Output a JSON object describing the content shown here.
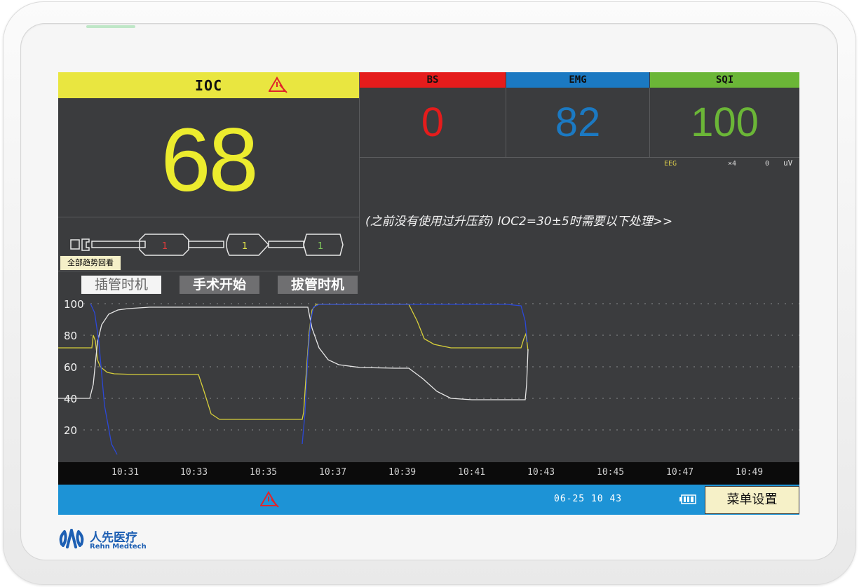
{
  "ioc": {
    "title": "IOC",
    "value": "68",
    "header_color": "#e9e640",
    "value_color": "#ecec2e"
  },
  "params": [
    {
      "label": "BS",
      "value": "0",
      "color": "#e51c1c"
    },
    {
      "label": "EMG",
      "value": "82",
      "color": "#1b79c2"
    },
    {
      "label": "SQI",
      "value": "100",
      "color": "#6bb637"
    }
  ],
  "eeg": {
    "label": "EEG",
    "gain": "×4",
    "zero": "0",
    "unit": "uV"
  },
  "advice": "(之前没有使用过升压药) IOC2=30±5时需要以下处理>>",
  "tube": {
    "segments": [
      "1",
      "1",
      "1"
    ],
    "segment_colors": [
      "#e23b3b",
      "#e4e64a",
      "#7ec75a"
    ]
  },
  "trend_review_button": "全部趋势回看",
  "events": [
    {
      "label": "插管时机",
      "active": true
    },
    {
      "label": "手术开始",
      "active": false
    },
    {
      "label": "拔管时机",
      "active": false
    }
  ],
  "trend": {
    "y_ticks": [
      "100",
      "80",
      "60",
      "40",
      "20"
    ],
    "x_ticks": [
      "10:31",
      "10:33",
      "10:35",
      "10:37",
      "10:39",
      "10:41",
      "10:43",
      "10:45",
      "10:47",
      "10:49"
    ],
    "series_colors": {
      "ioc": "#d7cf3a",
      "white": "#e6e6e6",
      "blue": "#2b48d8"
    }
  },
  "status": {
    "datetime": "06-25 10 43",
    "menu_label": "菜单设置",
    "battery_icon": "battery-icon",
    "alarm_icon": "alarm-warning-icon"
  },
  "brand": {
    "name_cn": "人先医疗",
    "name_en": "Rehn Medtech",
    "color": "#1d5fb3"
  }
}
